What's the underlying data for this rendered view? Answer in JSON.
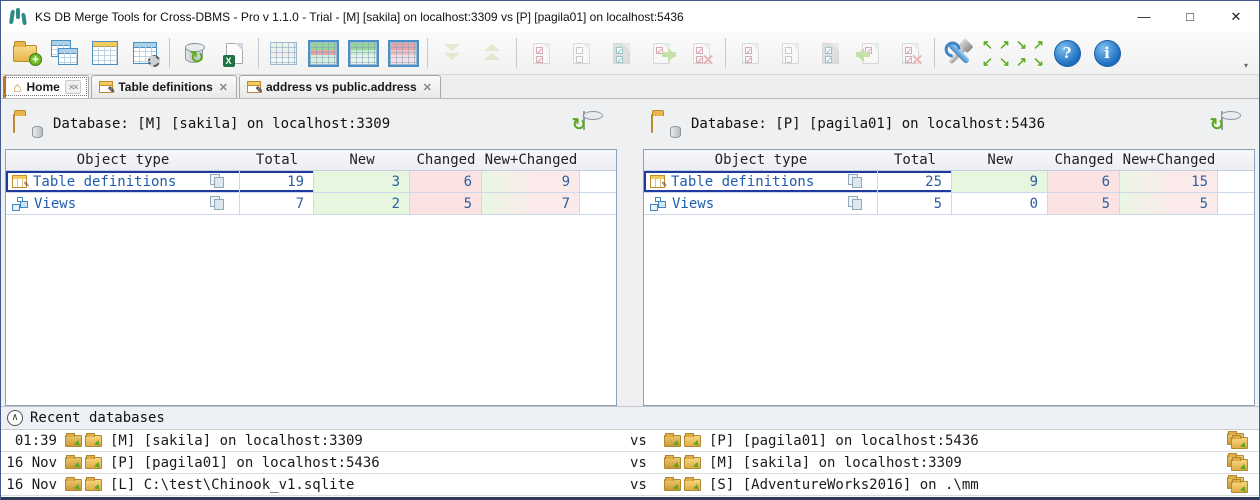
{
  "window": {
    "title": "KS DB Merge Tools for Cross-DBMS - Pro v 1.1.0 - Trial - [M] [sakila] on localhost:3309 vs [P] [pagila01] on localhost:5436",
    "controls": {
      "minimize": "—",
      "maximize": "□",
      "close": "✕"
    }
  },
  "toolbar": {
    "help_glyph": "?",
    "info_glyph": "i",
    "overflow_glyph": "▾",
    "nav_arrows": [
      "↖",
      "↗",
      "↘",
      "↗",
      "↙",
      "↘",
      "↗",
      "↘"
    ],
    "button_names": [
      "open-database",
      "schema-objects",
      "queries-at-a-glance",
      "table-settings",
      "refresh-all",
      "export-to-excel",
      "show-all-rows",
      "show-different-rows",
      "show-new-rows",
      "show-changed-rows",
      "next-difference",
      "previous-difference",
      "left-select-checked",
      "left-select-gray",
      "left-copy-to-right",
      "left-drop-selected",
      "right-select-checked",
      "right-select-empty",
      "right-select-gray",
      "right-copy-to-left",
      "right-drop-selected",
      "options-tools",
      "diff-navigation-arrows",
      "help",
      "about"
    ]
  },
  "tabs": {
    "home": {
      "label": "Home",
      "close_all": "××"
    },
    "items": [
      {
        "label": "Table definitions",
        "close": "✕"
      },
      {
        "label": "address vs public.address",
        "close": "✕"
      }
    ]
  },
  "columns": [
    "Object type",
    "Total",
    "New",
    "Changed",
    "New+Changed"
  ],
  "panels": {
    "left": {
      "header": "Database: [M] [sakila] on localhost:3309",
      "rows": [
        {
          "label": "Table definitions",
          "total": "19",
          "new": "3",
          "changed": "6",
          "new_changed": "9"
        },
        {
          "label": "Views",
          "total": "7",
          "new": "2",
          "changed": "5",
          "new_changed": "7"
        }
      ]
    },
    "right": {
      "header": "Database: [P] [pagila01] on localhost:5436",
      "rows": [
        {
          "label": "Table definitions",
          "total": "25",
          "new": "9",
          "changed": "6",
          "new_changed": "15"
        },
        {
          "label": "Views",
          "total": "5",
          "new": "0",
          "changed": "5",
          "new_changed": "5"
        }
      ]
    }
  },
  "recent": {
    "title": "Recent databases",
    "collapse_glyph": "∧",
    "vs_label": "vs",
    "rows": [
      {
        "time": "01:39",
        "left": "[M] [sakila] on localhost:3309",
        "right": "[P] [pagila01] on localhost:5436"
      },
      {
        "time": "16 Nov",
        "left": "[P] [pagila01] on localhost:5436",
        "right": "[M] [sakila] on localhost:3309"
      },
      {
        "time": "16 Nov",
        "left": "[L] C:\\test\\Chinook_v1.sqlite",
        "right": "[S] [AdventureWorks2016] on .\\mm"
      }
    ]
  },
  "colors": {
    "selection_border": "#1e3a9e",
    "link": "#1e5dae",
    "number": "#2d5f9e",
    "new_bg": "#e6f6df",
    "changed_bg": "#fbe3e3",
    "accent_green": "#6ab82e",
    "accent_blue": "#2f77c0"
  }
}
